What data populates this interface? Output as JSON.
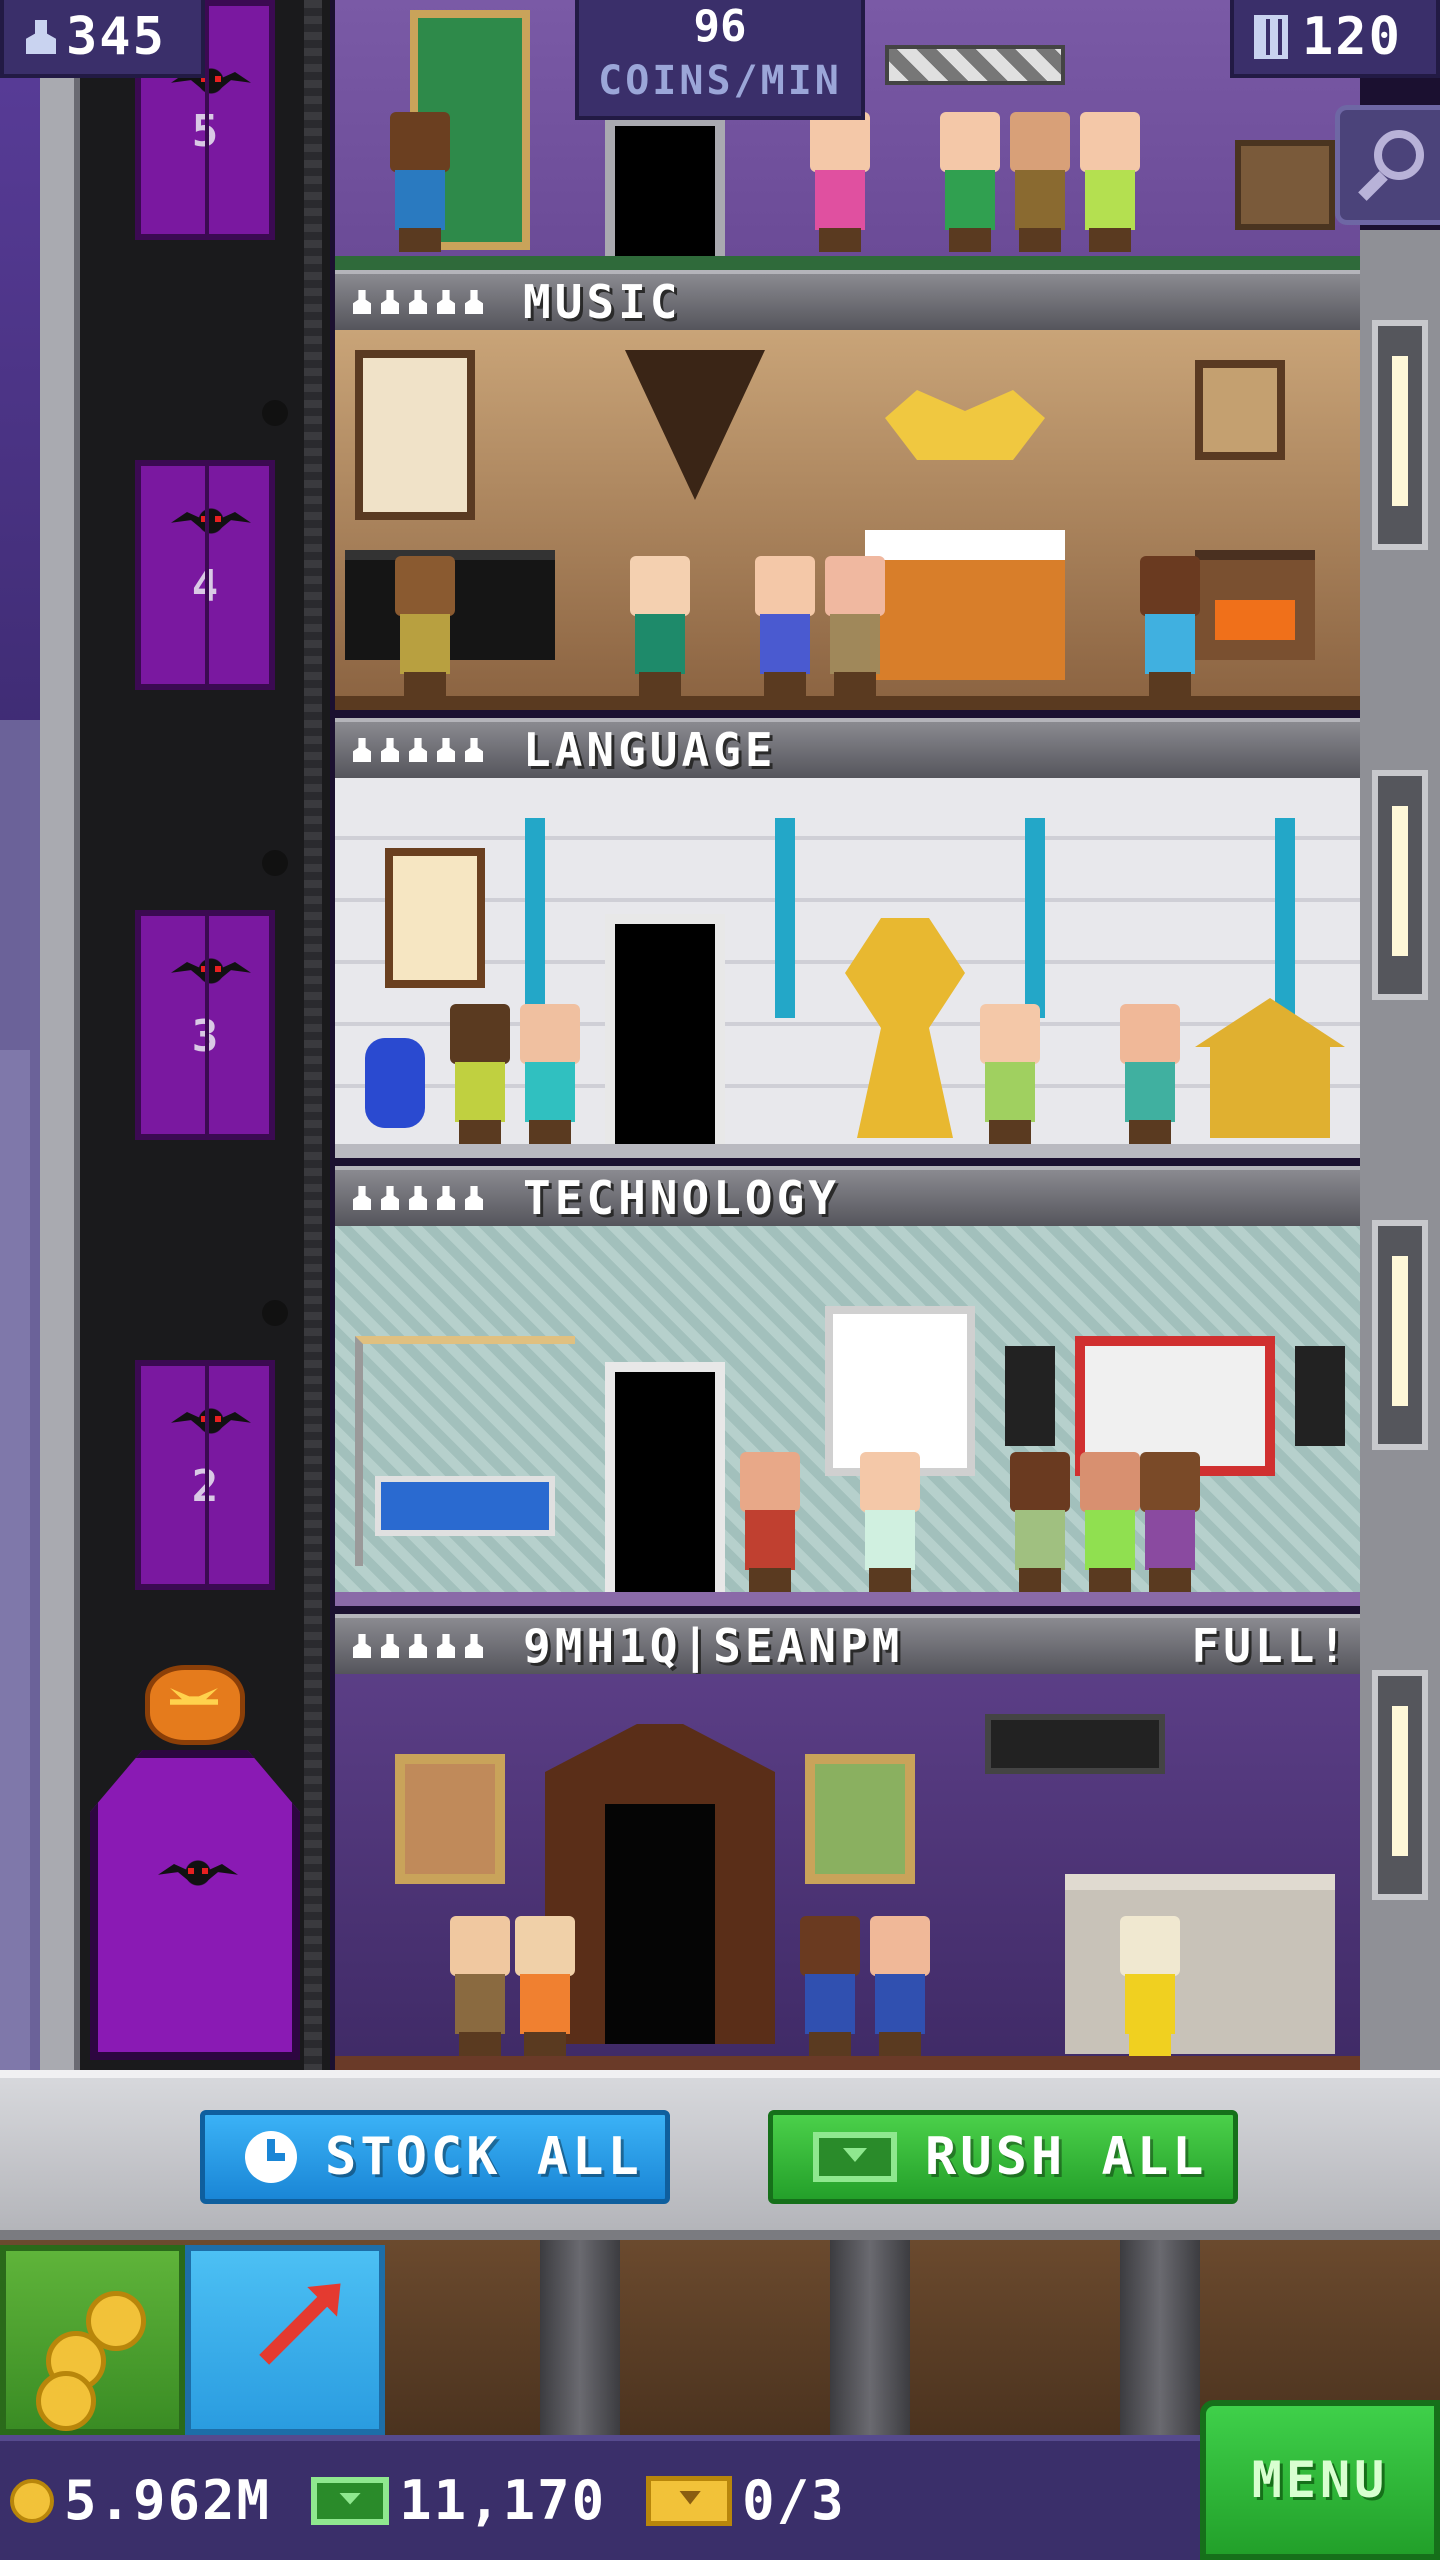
{
  "hud": {
    "population": "345",
    "coins_per_min_value": "96",
    "coins_per_min_label": "COINS/MIN",
    "floor_count": "120"
  },
  "elevator": {
    "floor_numbers": [
      "5",
      "4",
      "3",
      "2"
    ]
  },
  "floors": [
    {
      "name": "",
      "full_label": ""
    },
    {
      "name": "MUSIC",
      "full_label": ""
    },
    {
      "name": "LANGUAGE",
      "full_label": ""
    },
    {
      "name": "TECHNOLOGY",
      "full_label": ""
    },
    {
      "name": "9MH1Q|SEANPM",
      "full_label": "FULL!"
    }
  ],
  "actions": {
    "stock_all": "STOCK ALL",
    "rush_all": "RUSH ALL"
  },
  "bottom_hud": {
    "coins": "5.962M",
    "bux": "11,170",
    "tickets": "0/3",
    "menu": "MENU"
  },
  "icons": {
    "population": "person-icon",
    "floors": "building-icon",
    "zoom": "magnifier-icon",
    "stock": "clock-icon",
    "rush": "bux-icon",
    "coins": "coin-icon",
    "tickets": "ticket-icon",
    "items_tab": "arrow-icon"
  },
  "colors": {
    "stock_button": "#1a86d6",
    "rush_button": "#24a02a",
    "hud_bg": "#3a2f6a",
    "elevator_door": "#7a18a0"
  }
}
